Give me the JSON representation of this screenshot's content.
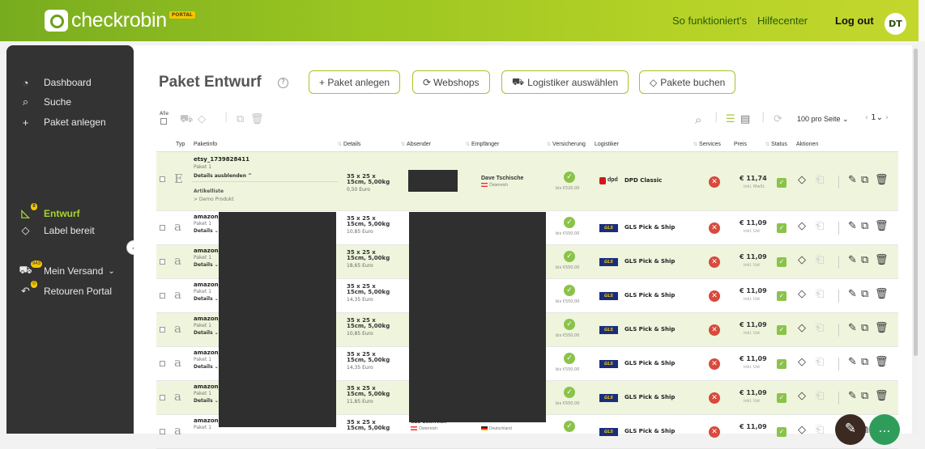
{
  "header": {
    "logo_text": "checkrobin",
    "portal_badge": "PORTAL",
    "nav": [
      "So funktioniert's",
      "Hilfecenter",
      "Log out"
    ],
    "avatar": "DT"
  },
  "sidebar": {
    "top_items": [
      {
        "label": "Dashboard",
        "icon": "dashboard-icon"
      },
      {
        "label": "Suche",
        "icon": "search-icon"
      },
      {
        "label": "Paket anlegen",
        "icon": "plus-icon"
      }
    ],
    "mid_items": [
      {
        "label": "Entwurf",
        "icon": "draft-icon",
        "badge": "8"
      },
      {
        "label": "Label bereit",
        "icon": "tag-icon"
      }
    ],
    "bottom_items": [
      {
        "label": "Mein Versand",
        "icon": "truck-icon",
        "badge": "943"
      },
      {
        "label": "Retouren Portal",
        "icon": "return-icon",
        "badge": "0"
      }
    ]
  },
  "page": {
    "title": "Paket Entwurf",
    "buttons": [
      "+ Paket anlegen",
      "Webshops",
      "Logistiker auswählen",
      "Pakete buchen"
    ],
    "select_all": "Alle",
    "per_page": "100 pro Seite",
    "page_num": "1"
  },
  "table": {
    "headers": [
      "Typ",
      "Paketinfo",
      "Details",
      "Absender",
      "Empfänger",
      "Versicherung",
      "Logistiker",
      "Services",
      "Preis",
      "Status",
      "Aktionen"
    ],
    "first_row": {
      "type": "E",
      "name": "etsy_1739828411",
      "sub": "Paket 1",
      "toggle": "Details ausblenden ^",
      "articles_label": "Artikelliste",
      "article": "> Demo Produkt",
      "dims": "35 x 25 x 15cm, 5,00kg",
      "value": "0,50 Euro",
      "recipient": "Dave Tschische",
      "recipient_country": "Österreich",
      "insurance": "bis €520,00",
      "carrier": "DPD Classic",
      "carrier_brand": "dpd",
      "price": "€ 11,74",
      "price_note": "inkl. MwSt."
    },
    "rows": [
      {
        "type": "a",
        "name": "amazon_",
        "sub": "Paket 1",
        "toggle": "Details ⌄",
        "dims": "35 x 25 x 15cm, 5,00kg",
        "value": "10,85 Euro",
        "insurance": "bis €550,00",
        "carrier": "GLS Pick & Ship",
        "price": "€ 11,09",
        "price_note": "inkl. Ust"
      },
      {
        "type": "a",
        "name": "amazon_",
        "sub": "Paket 1",
        "toggle": "Details ⌄",
        "dims": "35 x 25 x 15cm, 5,00kg",
        "value": "18,65 Euro",
        "insurance": "bis €550,00",
        "carrier": "GLS Pick & Ship",
        "price": "€ 11,09",
        "price_note": "inkl. Ust"
      },
      {
        "type": "a",
        "name": "amazon_",
        "sub": "Paket 1",
        "toggle": "Details ⌄",
        "dims": "35 x 25 x 15cm, 5,00kg",
        "value": "14,35 Euro",
        "insurance": "bis €550,00",
        "carrier": "GLS Pick & Ship",
        "price": "€ 11,09",
        "price_note": "inkl. Ust"
      },
      {
        "type": "a",
        "name": "amazon_",
        "sub": "Paket 1",
        "toggle": "Details ⌄",
        "dims": "35 x 25 x 15cm, 5,00kg",
        "value": "10,85 Euro",
        "insurance": "bis €550,00",
        "carrier": "GLS Pick & Ship",
        "price": "€ 11,09",
        "price_note": "inkl. Ust"
      },
      {
        "type": "a",
        "name": "amazon_",
        "sub": "Paket 1",
        "toggle": "Details ⌄",
        "dims": "35 x 25 x 15cm, 5,00kg",
        "value": "14,35 Euro",
        "insurance": "bis €550,00",
        "carrier": "GLS Pick & Ship",
        "price": "€ 11,09",
        "price_note": "inkl. Ust"
      },
      {
        "type": "a",
        "name": "amazon_",
        "sub": "Paket 1",
        "toggle": "Details ⌄",
        "dims": "35 x 25 x 15cm, 5,00kg",
        "value": "11,85 Euro",
        "insurance": "bis €550,00",
        "carrier": "GLS Pick & Ship",
        "price": "€ 11,09",
        "price_note": "inkl. Ust"
      },
      {
        "type": "a",
        "name": "amazon_",
        "sub": "Paket 1",
        "toggle": "",
        "dims": "35 x 25 x 15cm, 5,00kg",
        "value": "",
        "insurance": "",
        "carrier": "GLS Pick & Ship",
        "price": "€ 11,09",
        "price_note": "",
        "sender_partial": "GLS Österreich",
        "sender_country": "Österreich",
        "recipient_partial": "",
        "recipient_country": "Deutschland"
      }
    ]
  },
  "colors": {
    "brand_green": "#9cc621",
    "sidebar_bg": "#333333",
    "accent_active": "#a8d32d",
    "danger": "#d84a3c",
    "ok": "#8bc34a"
  }
}
